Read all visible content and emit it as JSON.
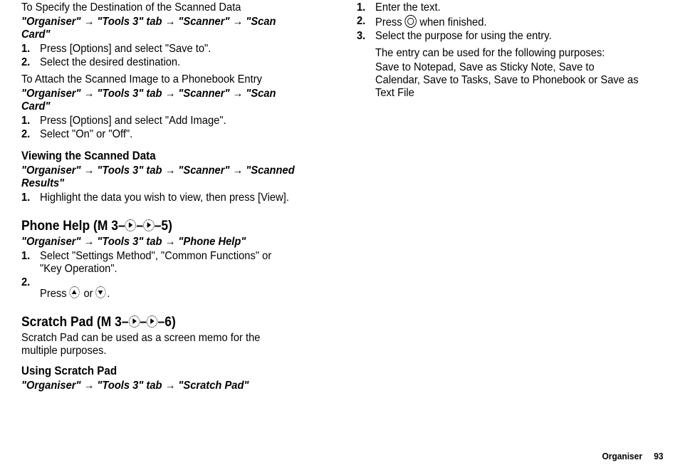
{
  "left": {
    "sec1": {
      "title": "To Specify the Destination of the Scanned Data",
      "path": "\"Organiser\" → \"Tools 3\" tab → \"Scanner\" → \"Scan Card\"",
      "step1": "Press [Options] and select \"Save to\".",
      "step2": "Select the desired destination."
    },
    "sec2": {
      "title": "To Attach the Scanned Image to a Phonebook Entry",
      "path": "\"Organiser\" → \"Tools 3\" tab → \"Scanner\" → \"Scan Card\"",
      "step1": "Press [Options] and select \"Add Image\".",
      "step2": "Select \"On\" or \"Off\"."
    },
    "sec3": {
      "heading": "Viewing the Scanned Data",
      "path": "\"Organiser\" → \"Tools 3\" tab → \"Scanner\" → \"Scanned Results\"",
      "step1": "Highlight the data you wish to view, then press [View]."
    },
    "phonehelp": {
      "title_a": "Phone Help (M 3–",
      "title_b": "–",
      "title_c": "–5)",
      "path": "\"Organiser\" → \"Tools 3\" tab → \"Phone Help\"",
      "step1": "Select \"Settings Method\", \"Common Functions\" or \"Key Operation\".",
      "step2a": "Press ",
      "step2b": " or ",
      "step2c": "."
    },
    "scratch": {
      "title_a": "Scratch Pad (M 3–",
      "title_b": "–",
      "title_c": "–6)",
      "desc": "Scratch Pad can be used as a screen memo for the multiple purposes.",
      "sub": "Using Scratch Pad",
      "path": "\"Organiser\" → \"Tools 3\" tab → \"Scratch Pad\""
    }
  },
  "right": {
    "step1": "Enter the text.",
    "step2a": "Press ",
    "step2b": " when finished.",
    "step3": "Select the purpose for using the entry.",
    "detail1": "The entry can be used for the following purposes:",
    "detail2": "Save to Notepad, Save as Sticky Note, Save to Calendar, Save to Tasks, Save to Phonebook or Save as Text File"
  },
  "footer": {
    "section": "Organiser",
    "page": "93"
  }
}
